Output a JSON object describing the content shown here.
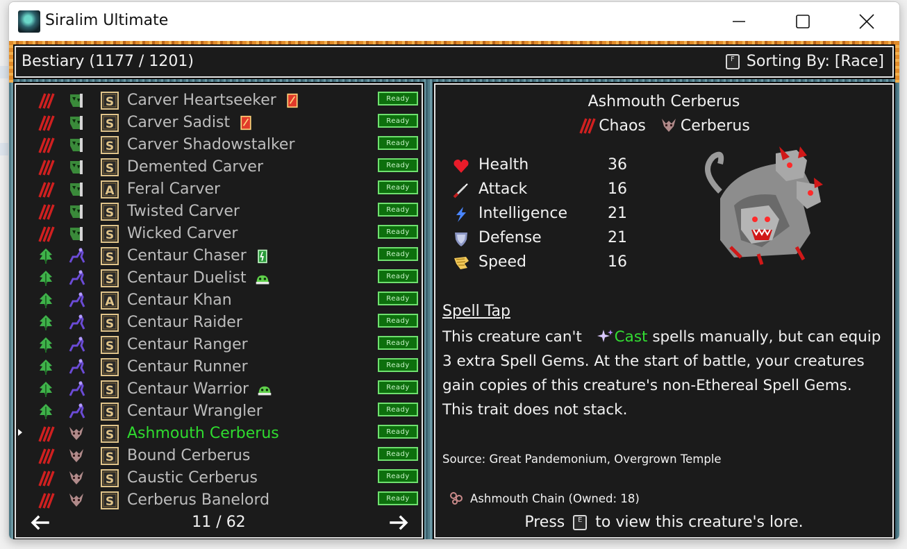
{
  "window": {
    "title": "Siralim Ultimate",
    "controls": [
      "minimize",
      "maximize",
      "close"
    ]
  },
  "header": {
    "title": "Bestiary (1177 / 1201)",
    "sort_key": "F",
    "sort_label": "Sorting By: [Race]"
  },
  "list": {
    "items": [
      {
        "name": "Carver Heartseeker",
        "race_icon": "chaos-claw-icon",
        "family_icon": "carver-icon",
        "class_icon": "S",
        "extra_icon": "card-icon",
        "status": "Ready"
      },
      {
        "name": "Carver Sadist",
        "race_icon": "chaos-claw-icon",
        "family_icon": "carver-icon",
        "class_icon": "S",
        "extra_icon": "card-icon",
        "status": "Ready"
      },
      {
        "name": "Carver Shadowstalker",
        "race_icon": "chaos-claw-icon",
        "family_icon": "carver-icon",
        "class_icon": "S",
        "extra_icon": "",
        "status": "Ready"
      },
      {
        "name": "Demented Carver",
        "race_icon": "chaos-claw-icon",
        "family_icon": "carver-icon",
        "class_icon": "S",
        "extra_icon": "",
        "status": "Ready"
      },
      {
        "name": "Feral Carver",
        "race_icon": "chaos-claw-icon",
        "family_icon": "carver-icon",
        "class_icon": "A",
        "extra_icon": "",
        "status": "Ready"
      },
      {
        "name": "Twisted Carver",
        "race_icon": "chaos-claw-icon",
        "family_icon": "carver-icon",
        "class_icon": "S",
        "extra_icon": "",
        "status": "Ready"
      },
      {
        "name": "Wicked Carver",
        "race_icon": "chaos-claw-icon",
        "family_icon": "carver-icon",
        "class_icon": "S",
        "extra_icon": "",
        "status": "Ready"
      },
      {
        "name": "Centaur Chaser",
        "race_icon": "nature-leaf-icon",
        "family_icon": "centaur-icon",
        "class_icon": "S",
        "extra_icon": "battery-icon",
        "status": "Ready"
      },
      {
        "name": "Centaur Duelist",
        "race_icon": "nature-leaf-icon",
        "family_icon": "centaur-icon",
        "class_icon": "S",
        "extra_icon": "slime-icon",
        "status": "Ready"
      },
      {
        "name": "Centaur Khan",
        "race_icon": "nature-leaf-icon",
        "family_icon": "centaur-icon",
        "class_icon": "A",
        "extra_icon": "",
        "status": "Ready"
      },
      {
        "name": "Centaur Raider",
        "race_icon": "nature-leaf-icon",
        "family_icon": "centaur-icon",
        "class_icon": "S",
        "extra_icon": "",
        "status": "Ready"
      },
      {
        "name": "Centaur Ranger",
        "race_icon": "nature-leaf-icon",
        "family_icon": "centaur-icon",
        "class_icon": "S",
        "extra_icon": "",
        "status": "Ready"
      },
      {
        "name": "Centaur Runner",
        "race_icon": "nature-leaf-icon",
        "family_icon": "centaur-icon",
        "class_icon": "S",
        "extra_icon": "",
        "status": "Ready"
      },
      {
        "name": "Centaur Warrior",
        "race_icon": "nature-leaf-icon",
        "family_icon": "centaur-icon",
        "class_icon": "S",
        "extra_icon": "slime-icon",
        "status": "Ready"
      },
      {
        "name": "Centaur Wrangler",
        "race_icon": "nature-leaf-icon",
        "family_icon": "centaur-icon",
        "class_icon": "S",
        "extra_icon": "",
        "status": "Ready"
      },
      {
        "name": "Ashmouth Cerberus",
        "race_icon": "chaos-claw-icon",
        "family_icon": "cerberus-icon",
        "class_icon": "S",
        "extra_icon": "",
        "status": "Ready",
        "selected": true
      },
      {
        "name": "Bound Cerberus",
        "race_icon": "chaos-claw-icon",
        "family_icon": "cerberus-icon",
        "class_icon": "S",
        "extra_icon": "",
        "status": "Ready"
      },
      {
        "name": "Caustic Cerberus",
        "race_icon": "chaos-claw-icon",
        "family_icon": "cerberus-icon",
        "class_icon": "S",
        "extra_icon": "",
        "status": "Ready"
      },
      {
        "name": "Cerberus Banelord",
        "race_icon": "chaos-claw-icon",
        "family_icon": "cerberus-icon",
        "class_icon": "S",
        "extra_icon": "",
        "status": "Ready"
      }
    ],
    "page": "11 / 62"
  },
  "detail": {
    "name": "Ashmouth Cerberus",
    "race": "Chaos",
    "family": "Cerberus",
    "stats": [
      {
        "label": "Health",
        "value": "36",
        "icon": "heart-icon"
      },
      {
        "label": "Attack",
        "value": "16",
        "icon": "sword-icon"
      },
      {
        "label": "Intelligence",
        "value": "21",
        "icon": "lightning-icon"
      },
      {
        "label": "Defense",
        "value": "21",
        "icon": "shield-icon"
      },
      {
        "label": "Speed",
        "value": "16",
        "icon": "wing-icon"
      }
    ],
    "trait_title": "Spell Tap",
    "trait_text_pre": "This creature can't ",
    "trait_cast": "Cast",
    "trait_text_post": " spells manually, but can equip 3 extra Spell Gems. At the start of battle, your creatures gain copies of this creature's non-Ethereal Spell Gems. This trait does not stack.",
    "source": "Source: Great Pandemonium, Overgrown Temple",
    "chain": "Ashmouth Chain (Owned: 18)",
    "lore_press": "Press",
    "lore_key": "E",
    "lore_suffix": "to view this creature's lore."
  },
  "colors": {
    "panel_bg": "#1b1b1b",
    "text": "#f2f2f2",
    "list_text": "#bdbdbd",
    "selected": "#2fdc2f",
    "ready_bg": "#0d6f0d",
    "chaos": "#d02020",
    "nature": "#3fb24a"
  }
}
